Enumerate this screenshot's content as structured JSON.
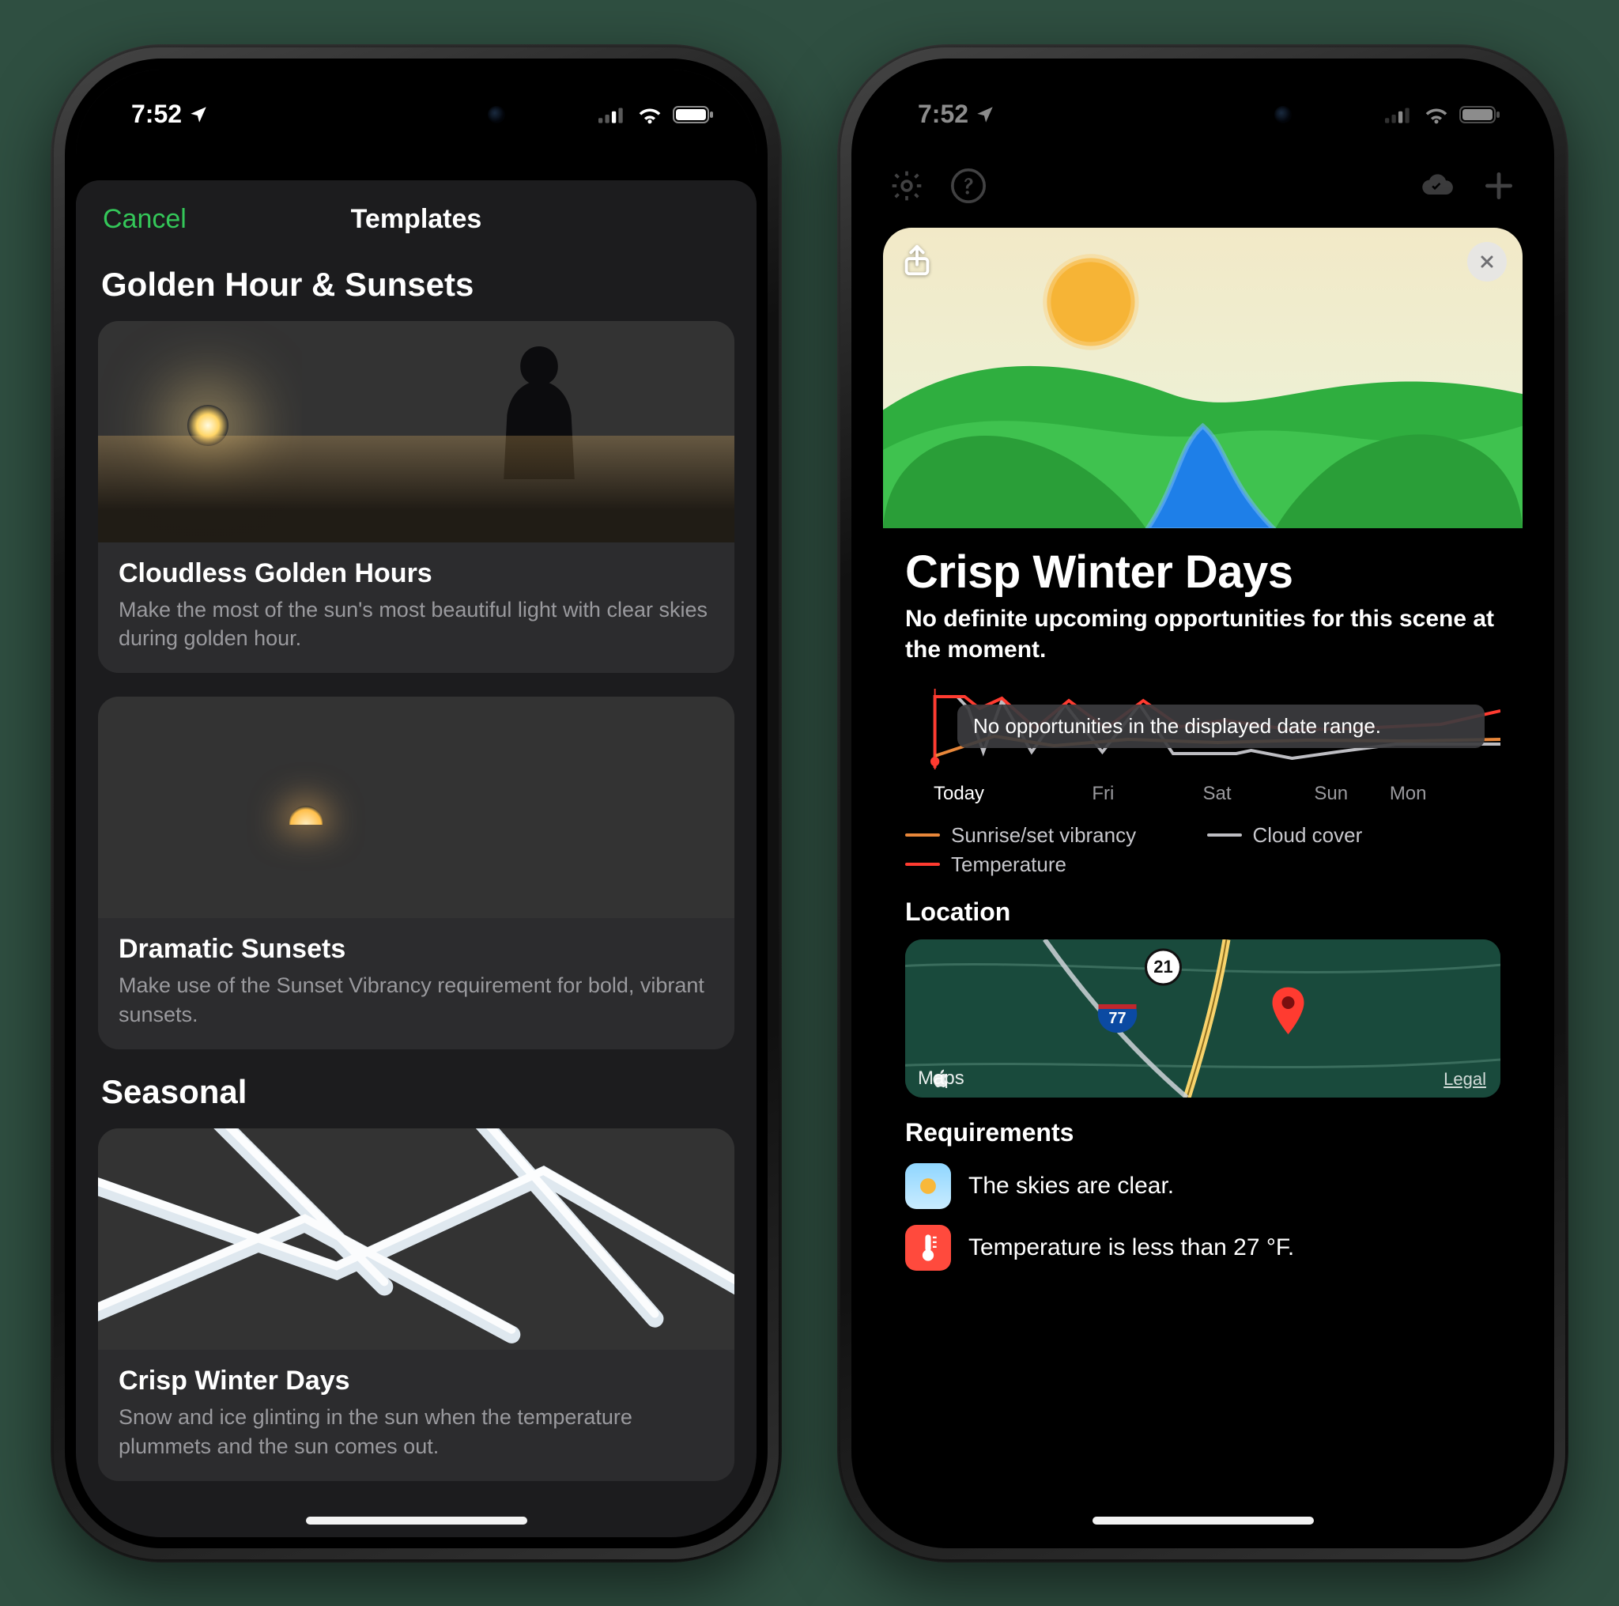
{
  "status_bar": {
    "time": "7:52",
    "location_on": true
  },
  "left_screen": {
    "nav": {
      "cancel": "Cancel",
      "title": "Templates"
    },
    "sections": [
      {
        "header": "Golden Hour & Sunsets",
        "cards": [
          {
            "title": "Cloudless Golden Hours",
            "desc": "Make the most of the sun's most beautiful light with clear skies during golden hour."
          },
          {
            "title": "Dramatic Sunsets",
            "desc": "Make use of the Sunset Vibrancy requirement for bold, vibrant sunsets."
          }
        ]
      },
      {
        "header": "Seasonal",
        "cards": [
          {
            "title": "Crisp Winter Days",
            "desc": "Snow and ice glinting in the sun when the temperature plummets and the sun comes out."
          }
        ]
      }
    ]
  },
  "right_screen": {
    "title": "Crisp Winter Days",
    "subtitle": "No definite upcoming opportunities for this scene at the moment.",
    "chart_toast": "No opportunities in the displayed date range.",
    "days": [
      "Today",
      "Fri",
      "Sat",
      "Sun",
      "Mon"
    ],
    "legend": {
      "vibrancy": "Sunrise/set vibrancy",
      "cloud": "Cloud cover",
      "temp": "Temperature"
    },
    "location_header": "Location",
    "map_brand": "Maps",
    "map_legal": "Legal",
    "map_shield_21": "21",
    "map_shield_77": "77",
    "requirements_header": "Requirements",
    "req_clear": "The skies are clear.",
    "req_temp": "Temperature is less than 27 °F."
  },
  "chart_data": {
    "type": "line",
    "x": [
      "Today",
      "Fri",
      "Sat",
      "Sun",
      "Mon"
    ],
    "series": [
      {
        "name": "Sunrise/set vibrancy",
        "color": "#e8873a",
        "values_est": [
          20,
          40,
          30,
          35,
          30
        ]
      },
      {
        "name": "Cloud cover",
        "color": "#bdbdc2",
        "values_est": [
          5,
          85,
          55,
          35,
          20
        ]
      },
      {
        "name": "Temperature",
        "color": "#ff3b30",
        "values_est": [
          10,
          85,
          78,
          80,
          60
        ]
      }
    ],
    "note": "Values are visual estimates (0–100 of chart height); chart has no y-axis labels."
  }
}
